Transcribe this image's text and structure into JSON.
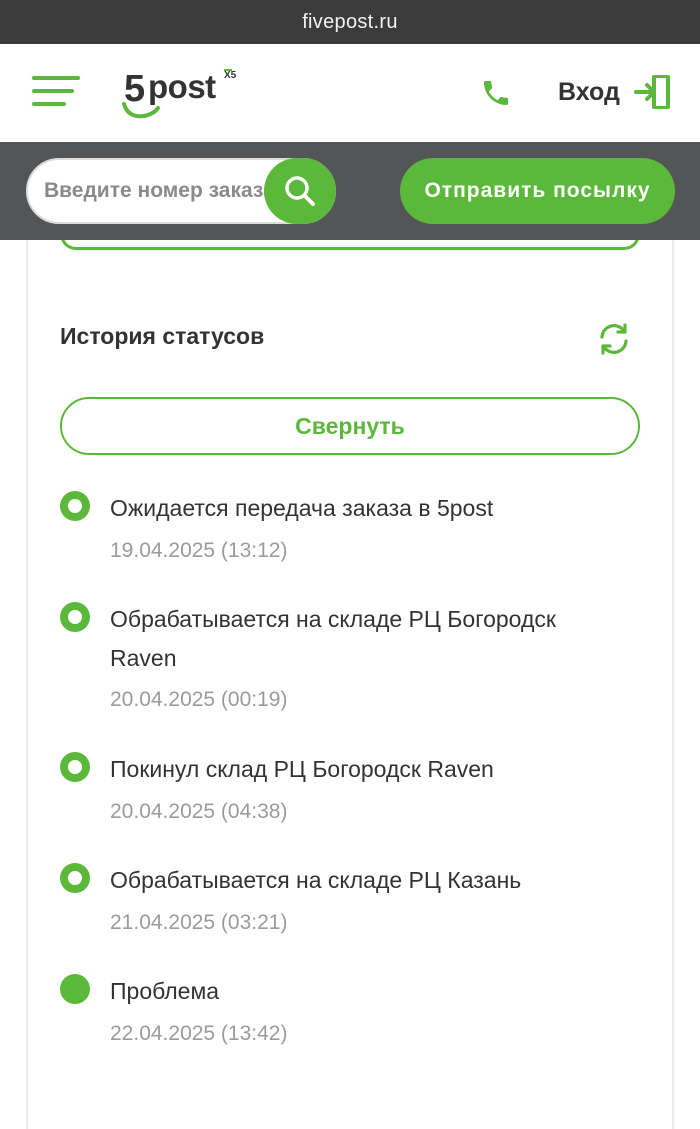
{
  "browser": {
    "url": "fivepost.ru"
  },
  "header": {
    "logo_five": "5",
    "logo_post": "post",
    "logo_x5": "X5",
    "login_label": "Вход"
  },
  "toolbar": {
    "search_placeholder": "Введите номер заказа",
    "send_label": "Отправить посылку"
  },
  "history": {
    "title": "История статусов",
    "collapse_label": "Свернуть",
    "items": [
      {
        "text": "Ожидается передача заказа в 5post",
        "date": "19.04.2025 (13:12)",
        "marker": "ring"
      },
      {
        "text": "Обрабатывается на складе РЦ Богородск Raven",
        "date": "20.04.2025 (00:19)",
        "marker": "ring"
      },
      {
        "text": "Покинул склад РЦ Богородск Raven",
        "date": "20.04.2025 (04:38)",
        "marker": "ring"
      },
      {
        "text": "Обрабатывается на складе РЦ Казань",
        "date": "21.04.2025 (03:21)",
        "marker": "ring"
      },
      {
        "text": "Проблема",
        "date": "22.04.2025 (13:42)",
        "marker": "filled"
      }
    ]
  },
  "colors": {
    "accent": "#5cb83a",
    "toolbar": "#535557",
    "urlbar": "#3b3b3b",
    "date": "#9b9b9b"
  },
  "icons": [
    "menu-icon",
    "phone-icon",
    "login-door-icon",
    "search-icon",
    "refresh-icon"
  ]
}
